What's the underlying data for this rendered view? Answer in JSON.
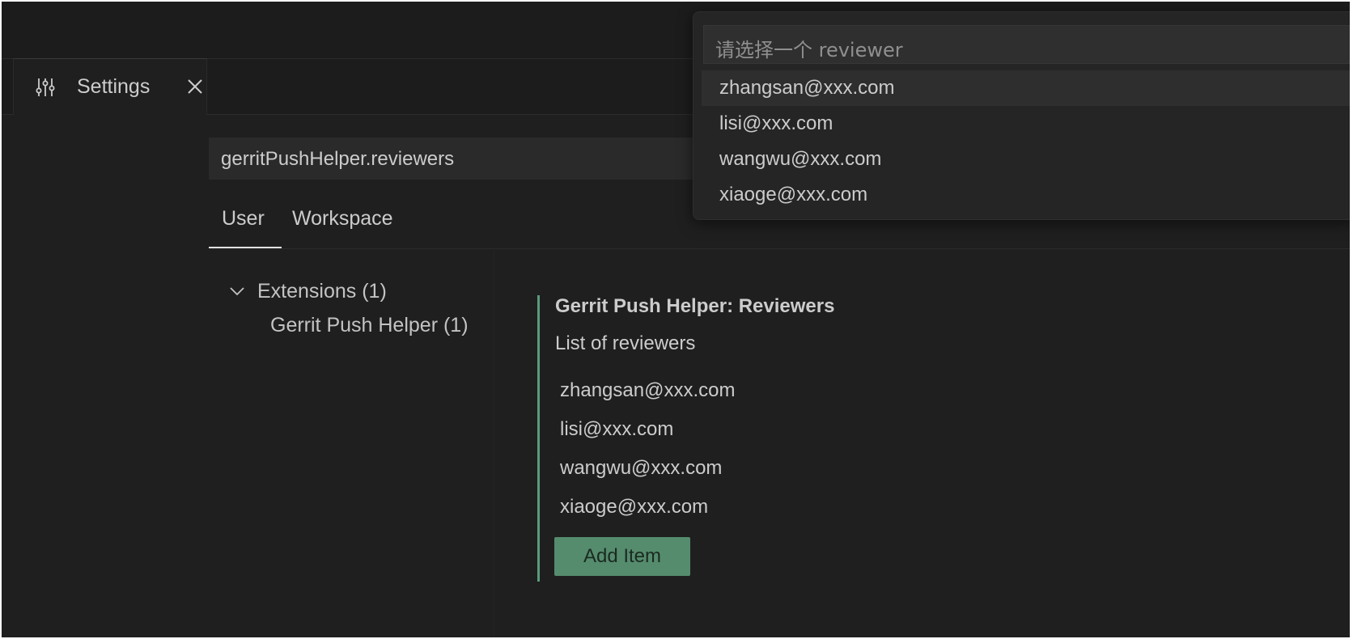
{
  "editor": {
    "tab_title": "Settings",
    "tab_icon": "settings-sliders-icon",
    "close_icon": "close-icon"
  },
  "settings": {
    "search_value": "gerritPushHelper.reviewers",
    "scopes": [
      "User",
      "Workspace"
    ],
    "active_scope": "User",
    "toc": {
      "group_label": "Extensions (1)",
      "child_label": "Gerrit Push Helper (1)"
    },
    "item": {
      "title": "Gerrit Push Helper: Reviewers",
      "description": "List of reviewers",
      "values": [
        "zhangsan@xxx.com",
        "lisi@xxx.com",
        "wangwu@xxx.com",
        "xiaoge@xxx.com"
      ],
      "add_label": "Add Item"
    }
  },
  "quick_pick": {
    "placeholder": "请选择一个 reviewer",
    "items": [
      "zhangsan@xxx.com",
      "lisi@xxx.com",
      "wangwu@xxx.com",
      "xiaoge@xxx.com"
    ],
    "active_index": 0
  },
  "colors": {
    "background": "#1f1f1f",
    "accent": "#5a9b7c",
    "button": "#558c6e",
    "text": "#cccccc"
  }
}
